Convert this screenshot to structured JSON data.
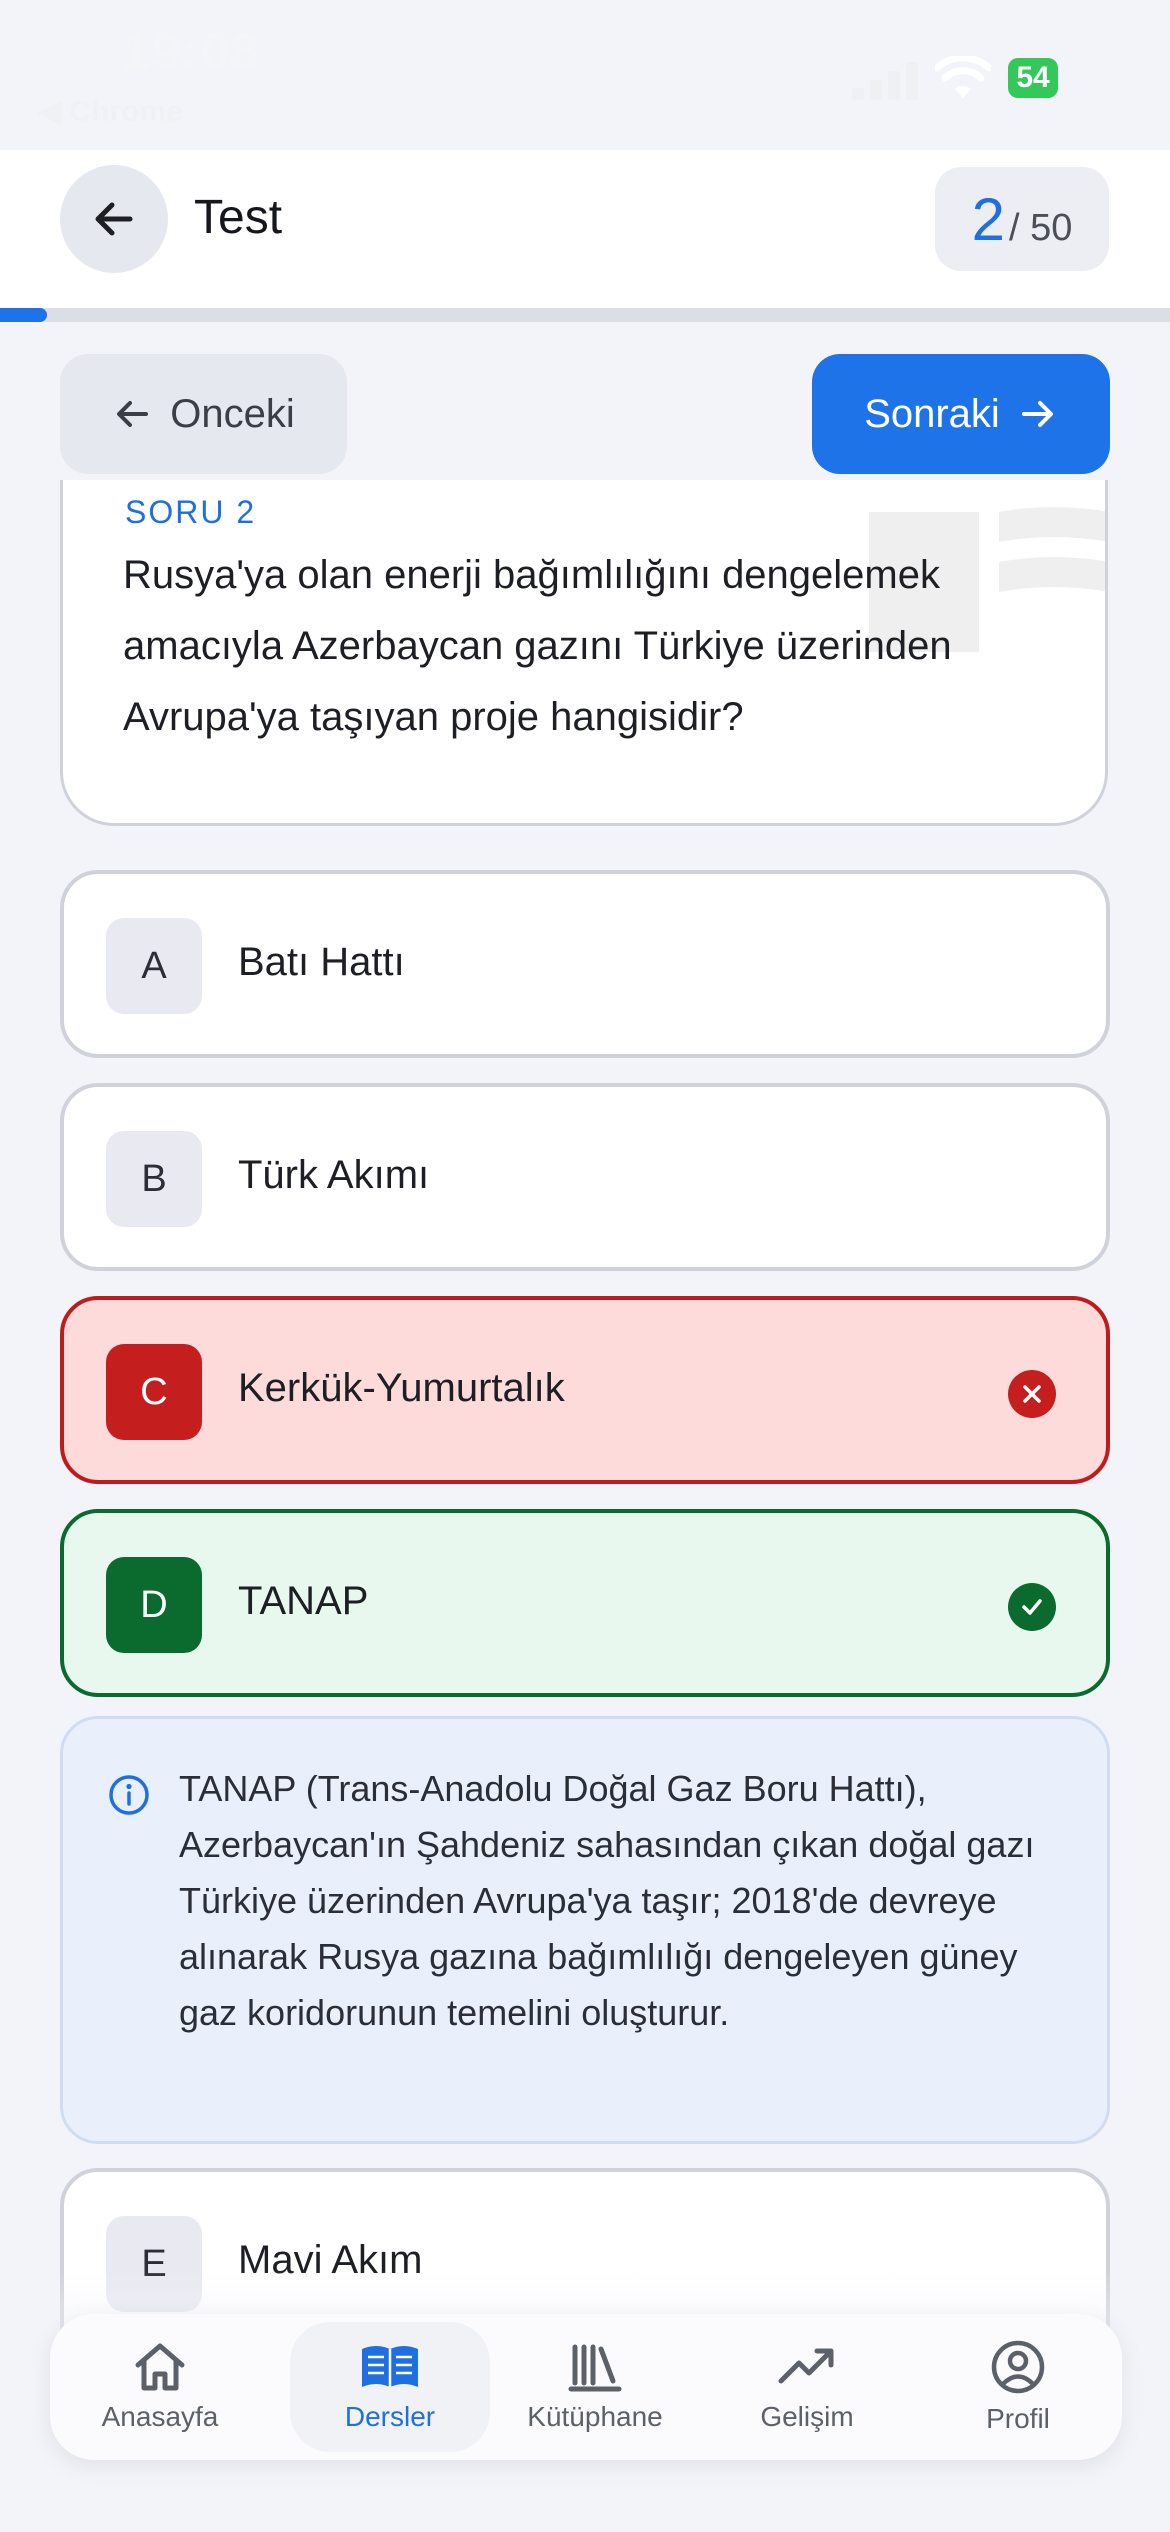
{
  "status_bar": {
    "time": "19:08",
    "back_app": "◀ Chrome",
    "battery": "54"
  },
  "header": {
    "title": "Test",
    "counter_current": "2",
    "counter_total": "/ 50",
    "progress_fraction": 0.04
  },
  "nav_buttons": {
    "prev_label": "Onceki",
    "next_label": "Sonraki"
  },
  "question": {
    "label": "SORU 2",
    "text": "Rusya'ya olan enerji bağımlılığını dengelemek amacıyla Azerbaycan gazını Türkiye üzerinden Avrupa'ya taşıyan proje hangisidir?"
  },
  "options": [
    {
      "letter": "A",
      "text": "Batı Hattı",
      "state": "neutral"
    },
    {
      "letter": "B",
      "text": "Türk Akımı",
      "state": "neutral"
    },
    {
      "letter": "C",
      "text": "Kerkük-Yumurtalık",
      "state": "wrong"
    },
    {
      "letter": "D",
      "text": "TANAP",
      "state": "correct"
    },
    {
      "letter": "E",
      "text": "Mavi Akım",
      "state": "neutral"
    }
  ],
  "explanation": {
    "text": "TANAP (Trans-Anadolu Doğal Gaz Boru Hattı), Azerbaycan'ın Şahdeniz sahasından çıkan doğal gazı Türkiye üzerinden Avrupa'ya taşır; 2018'de devreye alınarak Rusya gazına bağımlılığı dengeleyen güney gaz koridorunun temelini oluşturur."
  },
  "tabbar": {
    "items": [
      {
        "label": "Anasayfa",
        "icon": "home-icon"
      },
      {
        "label": "Dersler",
        "icon": "book-icon",
        "active": true
      },
      {
        "label": "Kütüphane",
        "icon": "library-icon"
      },
      {
        "label": "Gelişim",
        "icon": "trend-icon"
      },
      {
        "label": "Profil",
        "icon": "profile-icon"
      }
    ]
  },
  "colors": {
    "accent": "#1f73e8",
    "wrong": "#c41e1e",
    "correct": "#0b6a2e"
  }
}
